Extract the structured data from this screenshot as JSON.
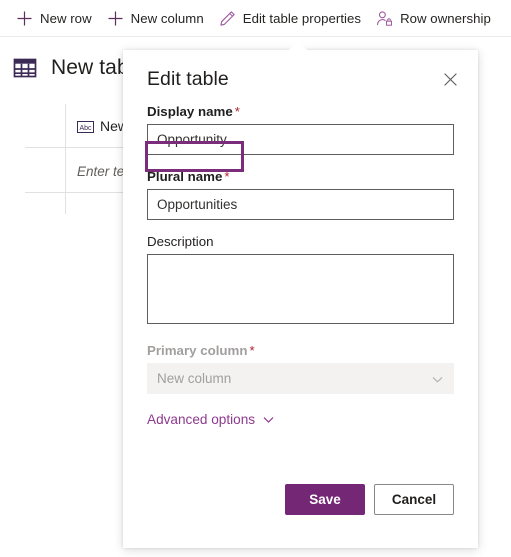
{
  "commandbar": {
    "items": [
      {
        "label": "New row",
        "icon": "plus-icon"
      },
      {
        "label": "New column",
        "icon": "plus-icon"
      },
      {
        "label": "Edit table properties",
        "icon": "pencil-icon"
      },
      {
        "label": "Row ownership",
        "icon": "person-lock-icon"
      }
    ]
  },
  "page": {
    "table_title": "New tab",
    "table_icon": "table-grid-icon",
    "column_header": {
      "icon": "abc-text-icon",
      "label": "New"
    },
    "cell_placeholder": "Enter te."
  },
  "dialog": {
    "title": "Edit table",
    "close_icon": "close-icon",
    "display_name": {
      "label": "Display name",
      "required": "*",
      "value": "Opportunity",
      "placeholder": ""
    },
    "plural_name": {
      "label": "Plural name",
      "required": "*",
      "value": "Opportunities",
      "placeholder": ""
    },
    "description": {
      "label": "Description",
      "value": "",
      "placeholder": ""
    },
    "primary_column": {
      "label": "Primary column",
      "required": "*",
      "value": "New column",
      "chevron_icon": "chevron-down-icon",
      "disabled": true
    },
    "advanced_options": {
      "label": "Advanced options",
      "chevron_icon": "chevron-down-icon"
    },
    "save_label": "Save",
    "cancel_label": "Cancel"
  },
  "colors": {
    "accent_purple": "#742774",
    "highlight_purple": "#7b2d7b",
    "link_purple": "#8e3a8e",
    "required_red": "#a4262c",
    "text_primary": "#201f1e",
    "disabled_text": "#a19f9d"
  }
}
